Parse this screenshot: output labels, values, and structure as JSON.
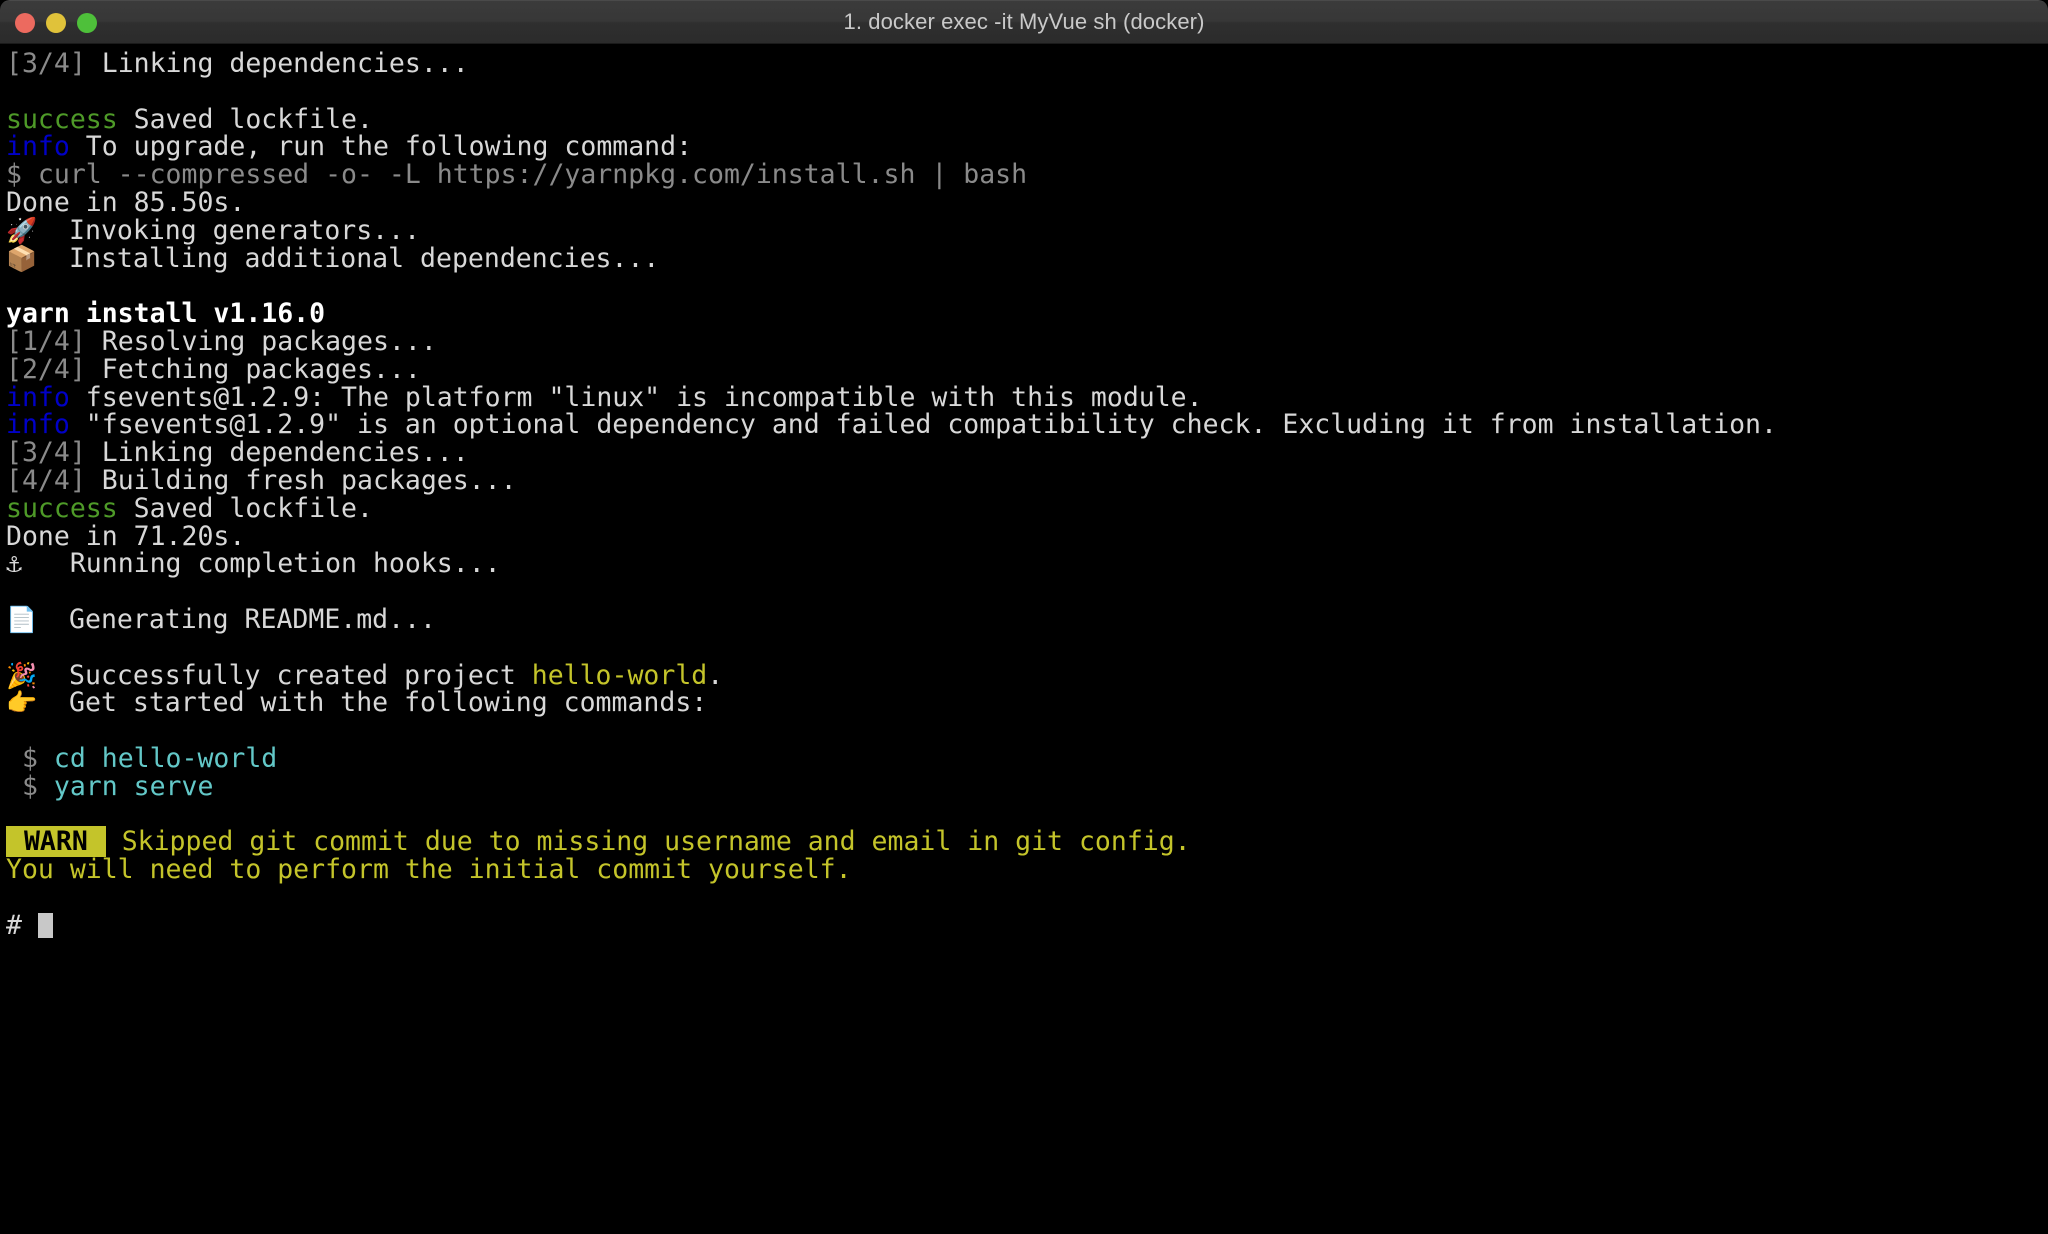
{
  "window": {
    "title": "1. docker exec -it MyVue sh (docker)",
    "traffic_lights": [
      {
        "name": "close",
        "color": "#ec6a5f"
      },
      {
        "name": "minimize",
        "color": "#e0c23a"
      },
      {
        "name": "maximize",
        "color": "#4ec03a"
      }
    ]
  },
  "colors": {
    "background": "#000000",
    "foreground": "#d8d8d8",
    "dim": "#8a8a8a",
    "success_green": "#4e9a28",
    "info_blue": "#0000c8",
    "warn_yellow": "#c4c42a",
    "command_cyan": "#63c8c8",
    "titlebar": "#373737",
    "cursor": "#c8c8c8"
  },
  "terminal": {
    "lines": [
      {
        "id": "l01",
        "segments": [
          {
            "text": "[3/4] ",
            "style": "dim"
          },
          {
            "text": "Linking dependencies...",
            "style": "default"
          }
        ]
      },
      {
        "id": "l02",
        "segments": []
      },
      {
        "id": "l03",
        "segments": [
          {
            "text": "success",
            "style": "green"
          },
          {
            "text": " Saved lockfile.",
            "style": "default"
          }
        ]
      },
      {
        "id": "l04",
        "segments": [
          {
            "text": "info",
            "style": "blue"
          },
          {
            "text": " To upgrade, run the following command:",
            "style": "default"
          }
        ]
      },
      {
        "id": "l05",
        "segments": [
          {
            "text": "$ curl --compressed -o- -L https://yarnpkg.com/install.sh | bash",
            "style": "dim"
          }
        ]
      },
      {
        "id": "l06",
        "segments": [
          {
            "text": "Done in 85.50s.",
            "style": "default"
          }
        ]
      },
      {
        "id": "l07",
        "segments": [
          {
            "text": "🚀",
            "style": "emoji"
          },
          {
            "text": "  Invoking generators...",
            "style": "default"
          }
        ]
      },
      {
        "id": "l08",
        "segments": [
          {
            "text": "📦",
            "style": "emoji"
          },
          {
            "text": "  Installing additional dependencies...",
            "style": "default"
          }
        ]
      },
      {
        "id": "l09",
        "segments": []
      },
      {
        "id": "l10",
        "segments": [
          {
            "text": "yarn install v1.16.0",
            "style": "bold"
          }
        ]
      },
      {
        "id": "l11",
        "segments": [
          {
            "text": "[1/4] ",
            "style": "dim"
          },
          {
            "text": "Resolving packages...",
            "style": "default"
          }
        ]
      },
      {
        "id": "l12",
        "segments": [
          {
            "text": "[2/4] ",
            "style": "dim"
          },
          {
            "text": "Fetching packages...",
            "style": "default"
          }
        ]
      },
      {
        "id": "l13",
        "segments": [
          {
            "text": "info",
            "style": "blue"
          },
          {
            "text": " fsevents@1.2.9: The platform \"linux\" is incompatible with this module.",
            "style": "default"
          }
        ]
      },
      {
        "id": "l14",
        "segments": [
          {
            "text": "info",
            "style": "blue"
          },
          {
            "text": " \"fsevents@1.2.9\" is an optional dependency and failed compatibility check. Excluding it from installation.",
            "style": "default"
          }
        ]
      },
      {
        "id": "l15",
        "segments": [
          {
            "text": "[3/4] ",
            "style": "dim"
          },
          {
            "text": "Linking dependencies...",
            "style": "default"
          }
        ]
      },
      {
        "id": "l16",
        "segments": [
          {
            "text": "[4/4] ",
            "style": "dim"
          },
          {
            "text": "Building fresh packages...",
            "style": "default"
          }
        ]
      },
      {
        "id": "l17",
        "segments": [
          {
            "text": "success",
            "style": "green"
          },
          {
            "text": " Saved lockfile.",
            "style": "default"
          }
        ]
      },
      {
        "id": "l18",
        "segments": [
          {
            "text": "Done in 71.20s.",
            "style": "default"
          }
        ]
      },
      {
        "id": "l19",
        "segments": [
          {
            "text": "⚓",
            "style": "default"
          },
          {
            "text": "   Running completion hooks...",
            "style": "default"
          }
        ]
      },
      {
        "id": "l20",
        "segments": []
      },
      {
        "id": "l21",
        "segments": [
          {
            "text": "📄",
            "style": "emoji"
          },
          {
            "text": "  Generating README.md...",
            "style": "default"
          }
        ]
      },
      {
        "id": "l22",
        "segments": []
      },
      {
        "id": "l23",
        "segments": [
          {
            "text": "🎉",
            "style": "emoji"
          },
          {
            "text": "  Successfully created project ",
            "style": "default"
          },
          {
            "text": "hello-world",
            "style": "yellow"
          },
          {
            "text": ".",
            "style": "default"
          }
        ]
      },
      {
        "id": "l24",
        "segments": [
          {
            "text": "👉",
            "style": "emoji"
          },
          {
            "text": "  Get started with the following commands:",
            "style": "default"
          }
        ]
      },
      {
        "id": "l25",
        "segments": []
      },
      {
        "id": "l26",
        "segments": [
          {
            "text": " $ ",
            "style": "dim"
          },
          {
            "text": "cd hello-world",
            "style": "cyan"
          }
        ]
      },
      {
        "id": "l27",
        "segments": [
          {
            "text": " $ ",
            "style": "dim"
          },
          {
            "text": "yarn serve",
            "style": "cyan"
          }
        ]
      },
      {
        "id": "l28",
        "segments": []
      },
      {
        "id": "l29",
        "segments": [
          {
            "text": " WARN ",
            "style": "warnbadge"
          },
          {
            "text": " Skipped git commit due to missing username and email in git config.",
            "style": "yellow"
          }
        ]
      },
      {
        "id": "l30",
        "segments": [
          {
            "text": "You will need to perform the initial commit yourself.",
            "style": "yellow"
          }
        ]
      },
      {
        "id": "l31",
        "segments": []
      },
      {
        "id": "l32",
        "segments": [
          {
            "text": "# ",
            "style": "default"
          }
        ],
        "cursor": true
      }
    ]
  }
}
